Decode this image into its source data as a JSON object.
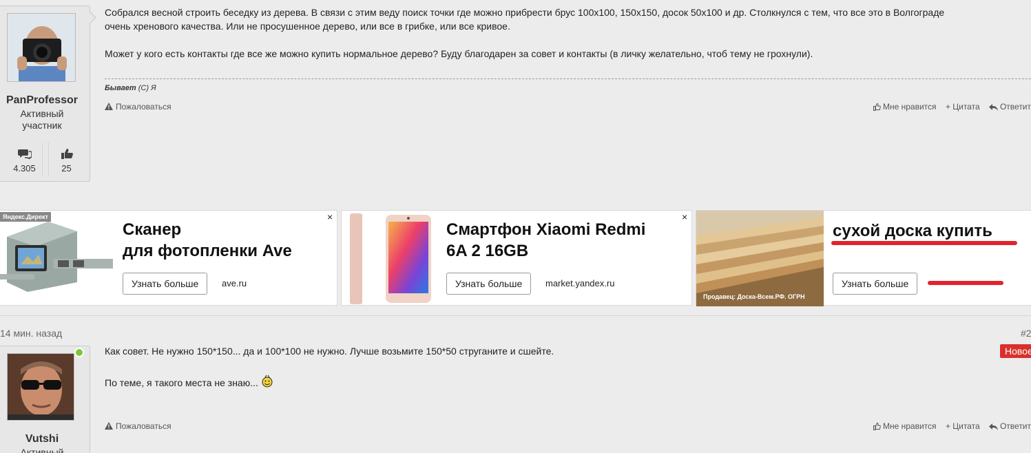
{
  "post1": {
    "username": "PanProfessor",
    "role_line1": "Активный",
    "role_line2": "участник",
    "stats": {
      "messages": "4.305",
      "likes": "25"
    },
    "text_line1": "Собрался весной строить беседку из дерева. В связи с этим веду поиск точки где можно прибрести брус 100x100, 150x150, досок 50x100 и др. Столкнулся с тем, что все это в Волгограде",
    "text_line2": "очень хренового качества. Или не просушенное дерево, или все в грибке, или все кривое.",
    "text_line3": "Может у кого есть контакты где все же можно купить нормальное дерево? Буду благодарен за совет и контакты (в личку желательно, чтоб тему не грохнули).",
    "signature_bold": "Бывает",
    "signature_rest": " (С) Я",
    "report": "Пожаловаться",
    "like": "Мне нравится",
    "quote": "+ Цитата",
    "reply": "Ответить"
  },
  "ads": {
    "direct_label": "Яндекс.Директ",
    "ad1": {
      "title_line1": "Сканер",
      "title_line2": "для фотопленки Ave",
      "button": "Узнать больше",
      "domain": "ave.ru",
      "close": "×"
    },
    "ad2": {
      "title_line1": "Смартфон Xiaomi Redmi",
      "title_line2": "6A 2 16GB",
      "button": "Узнать больше",
      "domain": "market.yandex.ru",
      "close": "×"
    },
    "ad3": {
      "title": "сухой доска купить",
      "button": "Узнать больше",
      "seller": "Продавец: Доска-Всем.РФ. ОГРН"
    }
  },
  "post2": {
    "time": "14 мин. назад",
    "number": "#2",
    "badge": "Новое",
    "text_line1": "Как совет. Не нужно 150*150... да и 100*100 не нужно. Лучше возьмите 150*50 струганите и сшейте.",
    "text_line2": "По теме, я такого места не знаю...",
    "report": "Пожаловаться",
    "like": "Мне нравится",
    "quote": "+ Цитата",
    "reply": "Ответить",
    "username": "Vutshi",
    "role_line1": "Активный"
  },
  "colors": {
    "background": "#ececec",
    "badge_red": "#d9302c",
    "online_green": "#7cc63a",
    "underline_red": "#e0242f"
  }
}
